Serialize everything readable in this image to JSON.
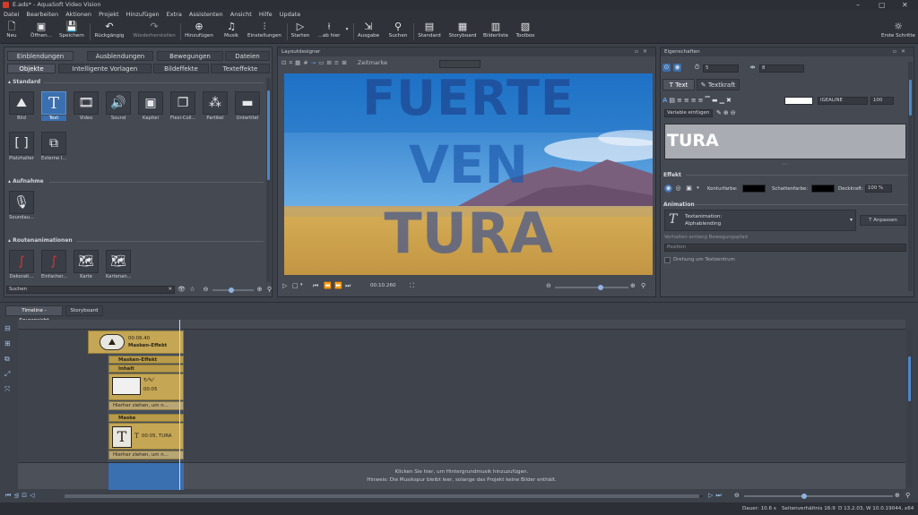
{
  "window": {
    "title": "E.ads* - AquaSoft Video Vision"
  },
  "menu": [
    "Datei",
    "Bearbeiten",
    "Aktionen",
    "Projekt",
    "Hinzufügen",
    "Extra",
    "Assistenten",
    "Ansicht",
    "Hilfe",
    "Update"
  ],
  "toolbar": {
    "neu": "Neu",
    "oeffnen": "Öffnen...",
    "speichern": "Speichern",
    "rueckgaengig": "Rückgängig",
    "wiederherstellen": "Wiederherstellen",
    "hinzufuegen": "Hinzufügen",
    "musik": "Musik",
    "einstellungen": "Einstellungen",
    "starten": "Starten",
    "ab_hier": "...ab hier",
    "ausgabe": "Ausgabe",
    "suchen": "Suchen",
    "standard": "Standard",
    "storyboard": "Storyboard",
    "bilderliste": "Bilderliste",
    "toolbox": "Toolbox",
    "erste_schritte": "Erste Schritte"
  },
  "toolbox": {
    "tabs_top": [
      "Einblendungen",
      "Ausblendungen",
      "Bewegungen",
      "Dateien"
    ],
    "tabs_bottom": [
      "Objekte",
      "Intelligente Vorlagen",
      "Bildeffekte",
      "Texteffekte"
    ],
    "sections": {
      "standard": "Standard",
      "aufnahme": "Aufnahme",
      "routen": "Routenanimationen"
    },
    "standard_items": [
      "Bild",
      "Text",
      "Video",
      "Sound",
      "Kapitel",
      "Flexi-Coll...",
      "Partikel",
      "Untertitel",
      "Platzhalter",
      "Externe I..."
    ],
    "aufnahme_items": [
      "Soundau..."
    ],
    "routen_items": [
      "Dekorati...",
      "Einfacher...",
      "Karte",
      "Kartenan..."
    ],
    "search_placeholder": "Suchen"
  },
  "layout_designer": {
    "title": "Layoutdesigner",
    "zoom_label": "Zeitmarke",
    "preview_text": [
      "FUERTE",
      "VEN",
      "TURA"
    ],
    "time": "00:10.260"
  },
  "properties": {
    "title": "Eigenschaften",
    "field1": "5",
    "field2": "8",
    "tabs": [
      "Text",
      "Textkraft"
    ],
    "font_name": "IGEALINE",
    "font_size": "100",
    "variable_label": "Variable einfügen",
    "text_value": "TURA",
    "effekt_label": "Effekt",
    "konturfarbe": "Konturfarbe:",
    "schattenfarbe": "Schattenfarbe:",
    "deckkraft": "Deckkraft:",
    "deckkraft_value": "100 %",
    "animation_label": "Animation",
    "anim_title": "Textanimation:",
    "anim_value": "Alphablending",
    "anpassen": "Anpassen",
    "bewegungspfad_label": "Verhalten entlang Bewegungspfad",
    "bewegungspfad_value": "Position",
    "drehung": "Drehung um Textzentrum"
  },
  "timeline": {
    "tabs": [
      "Timeline - Spuransicht",
      "Storyboard"
    ],
    "block_time": "00:06.40",
    "block_name": "Masken-Effekt",
    "masken_effekt": "Masken-Effekt",
    "inhalt": "Inhalt",
    "inhalt_time": "00:05",
    "inhalt_sub": "Hierher ziehen, um n...",
    "maske": "Maske",
    "maske_time": "00:05, TURA",
    "maske_sub": "Hierher ziehen, um n...",
    "hint1": "Klicken Sie hier, um Hintergrundmusik hinzuzufügen.",
    "hint2": "Hinweis: Die Musikspur bleibt leer, solange das Projekt keine Bilder enthält."
  },
  "status": {
    "dauer": "Dauer: 10.6 s",
    "seitenverhaeltnis": "Seitenverhältnis 16:9",
    "version": "D 13.2.03, W 10.0.19044, x64"
  },
  "colors": {
    "accent": "#3a6fb0",
    "track": "#c4a654",
    "preview_sky": "#2e7ac8",
    "sand": "#c89a4c"
  }
}
